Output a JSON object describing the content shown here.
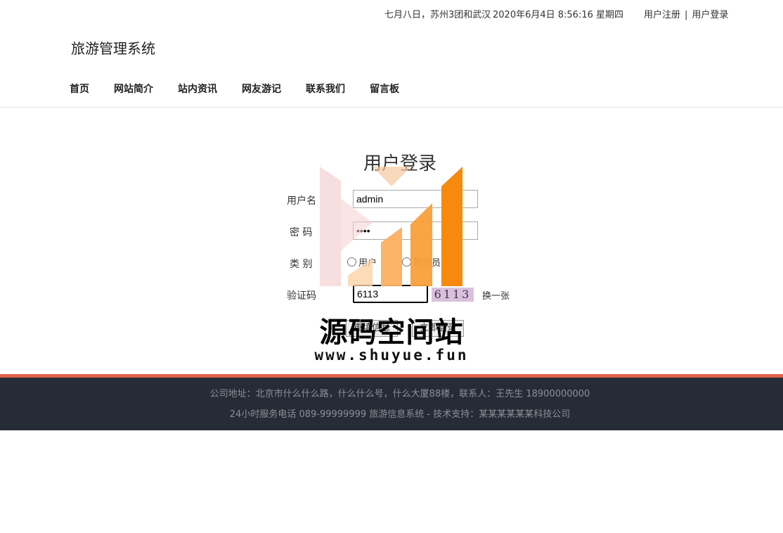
{
  "topbar": {
    "marquee": "七月八日，苏州3团和武汉",
    "clock": "2020年6月4日 8:56:16 星期四",
    "register": "用户注册",
    "separator": "|",
    "login": "用户登录"
  },
  "site": {
    "logo": "旅游管理系统"
  },
  "nav": [
    "首页",
    "网站简介",
    "站内资讯",
    "网友游记",
    "联系我们",
    "留言板"
  ],
  "login": {
    "title": "用户登录",
    "username_label": "用户名",
    "username_value": "admin",
    "password_label": "密 码",
    "password_value": "••••",
    "type_label": "类 别",
    "type_options": [
      "用户",
      "管理员"
    ],
    "captcha_label": "验证码",
    "captcha_value": "6113",
    "captcha_image": "6113",
    "refresh": "换一张",
    "btn_reset": "重填信息",
    "btn_submit": "立即登录"
  },
  "watermark": {
    "text": "源码空间站",
    "url": "www.shuyue.fun"
  },
  "footer": {
    "line1": "公司地址：北京市什么什么路，什么什么号，什么大厦88楼，联系人：王先生 18900000000",
    "line2": "24小时服务电话   089-99999999   旅游信息系统 - 技术支持：某某某某某某科技公司"
  },
  "colors": {
    "footer_bg": "#262c36",
    "footer_accent": "#e0624e",
    "watermark_orange": "#f7890d"
  }
}
